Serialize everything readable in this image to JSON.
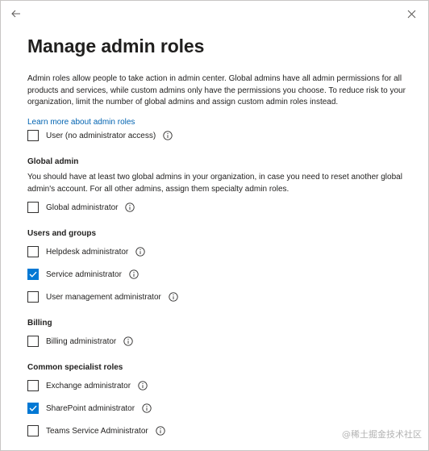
{
  "panel": {
    "title": "Manage admin roles",
    "intro": "Admin roles allow people to take action in admin center. Global admins have all admin permissions for all products and services, while custom admins only have the permissions you choose. To reduce risk to your organization, limit the number of global admins and assign custom admin roles instead.",
    "learn_more": "Learn more about admin roles"
  },
  "user_role": {
    "label": "User (no administrator access)",
    "checked": false
  },
  "global_admin": {
    "heading": "Global admin",
    "description": "You should have at least two global admins in your organization, in case you need to reset another global admin's account. For all other admins, assign them specialty admin roles.",
    "roles": [
      {
        "label": "Global administrator",
        "checked": false
      }
    ]
  },
  "users_and_groups": {
    "heading": "Users and groups",
    "roles": [
      {
        "label": "Helpdesk administrator",
        "checked": false
      },
      {
        "label": "Service administrator",
        "checked": true
      },
      {
        "label": "User management administrator",
        "checked": false
      }
    ]
  },
  "billing": {
    "heading": "Billing",
    "roles": [
      {
        "label": "Billing administrator",
        "checked": false
      }
    ]
  },
  "common_specialist": {
    "heading": "Common specialist roles",
    "roles": [
      {
        "label": "Exchange administrator",
        "checked": false
      },
      {
        "label": "SharePoint administrator",
        "checked": true
      },
      {
        "label": "Teams Service Administrator",
        "checked": false
      }
    ]
  },
  "watermark": "@稀土掘金技术社区",
  "icons": {
    "back": "arrow-left-icon",
    "close": "close-icon",
    "info": "info-icon",
    "check": "checkmark-icon"
  },
  "colors": {
    "link": "#0063b1",
    "checkbox_checked": "#0078d4",
    "text": "#201f1e"
  }
}
